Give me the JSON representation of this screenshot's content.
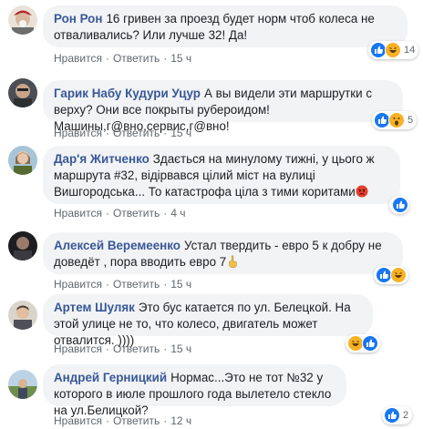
{
  "comments": [
    {
      "author": "Рон Рон",
      "text": "16 гривен за проезд будет норм чтоб колеса не отваливались? Или лучше 32! Да!",
      "like": "Нравится",
      "reply": "Ответить",
      "time": "15 ч",
      "reaction_count": "14",
      "reactions": [
        "like-icon",
        "laugh-icon"
      ]
    },
    {
      "author": "Гарик Набу Кудури Уцур",
      "text": "А вы видели эти маршрутки с верху? Они все покрыты рубероидом! Машины,г@вно,сервис,г@вно!",
      "like": "Нравится",
      "reply": "Ответить",
      "time": "15 ч",
      "reaction_count": "5",
      "reactions": [
        "like-icon",
        "wow-icon"
      ]
    },
    {
      "author": "Дар'я Житченко",
      "text": "Здається на минулому тижні, у цього ж маршрута #32, відірвався цілий міст на вулиці Вишгородська... То катастрофа ціла з тими коритами",
      "inline_emoji": "angry-face-emoji",
      "like": "Нравится",
      "reply": "Ответить",
      "time": "4 ч",
      "reaction_count": "",
      "reactions": [
        "like-icon"
      ]
    },
    {
      "author": "Алексей Веремеенко",
      "text": "Устал твердить - евро 5 к добру не доведёт , пора вводить евро 7",
      "inline_emoji": "pointing-finger-emoji",
      "like": "Нравится",
      "reply": "Ответить",
      "time": "15 ч",
      "reaction_count": "",
      "reactions": [
        "like-icon",
        "laugh-icon"
      ]
    },
    {
      "author": "Артем Шуляк",
      "text": "Это бус катается по ул. Белецкой. На этой улице не то, что колесо, двигатель может отвалится. ))))",
      "like": "Нравится",
      "reply": "Ответить",
      "time": "15 ч",
      "reaction_count": "",
      "reactions": [
        "laugh-icon",
        "like-icon"
      ]
    },
    {
      "author": "Андрей Герницкий",
      "text": "Нормас...Это не тот №32 у которого в июле прошлого года вылетело стекло на ул.Белицкой?",
      "like": "Нравится",
      "reply": "Ответить",
      "time": "12 ч",
      "reaction_count": "2",
      "reactions": [
        "like-icon"
      ]
    }
  ],
  "colors": {
    "author": "#385898",
    "bubble": "#f2f3f5",
    "like_blue": "#1877f2",
    "meta": "#606770"
  }
}
